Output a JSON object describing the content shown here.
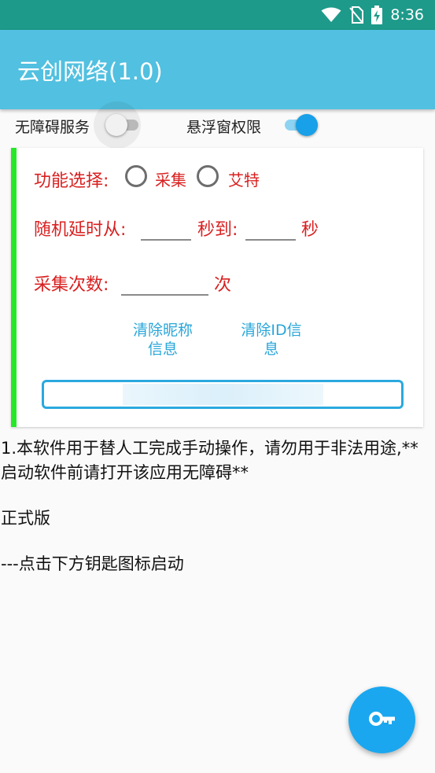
{
  "status_bar": {
    "time": "8:36",
    "icons": [
      "wifi-icon",
      "no-sim-icon",
      "battery-charging-icon"
    ]
  },
  "app_bar": {
    "title": "云创网络(1.0)"
  },
  "permissions": {
    "accessibility_label": "无障碍服务",
    "accessibility_enabled": false,
    "overlay_label": "悬浮窗权限",
    "overlay_enabled": true
  },
  "card": {
    "function_label": "功能选择:",
    "options": [
      {
        "label": "采集",
        "selected": false
      },
      {
        "label": "艾特",
        "selected": false
      }
    ],
    "delay_label": "随机延时从:",
    "delay_from_value": "",
    "delay_to_label": "秒到:",
    "delay_to_value": "",
    "delay_unit": "秒",
    "count_label": "采集次数:",
    "count_value": "",
    "count_unit": "次",
    "clear_nickname_button": "清除昵称信息",
    "clear_id_button": "清除ID信息"
  },
  "info": {
    "line1": "1.本软件用于替人工完成手动操作，请勿用于非法用途,**启动软件前请打开该应用无障碍**",
    "line2": "正式版",
    "line3": "---点击下方钥匙图标启动"
  },
  "fab": {
    "icon": "key-icon"
  },
  "colors": {
    "status_bar": "#1e9a8a",
    "app_bar": "#52c0e0",
    "accent": "#18a0e8",
    "label_red": "#d92020",
    "card_stripe": "#27e827",
    "link": "#29a6d9"
  }
}
